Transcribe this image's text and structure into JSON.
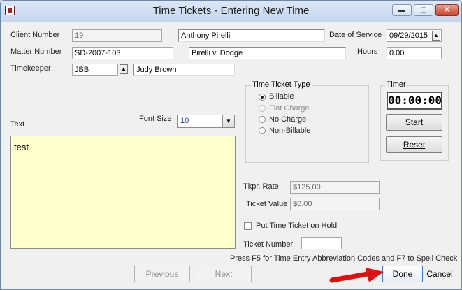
{
  "window": {
    "title": "Time Tickets - Entering New Time",
    "controls": {
      "minimize": "▬",
      "maximize": "▢",
      "close": "✕"
    }
  },
  "client": {
    "label": "Client Number",
    "number": "19",
    "name": "Anthony Pirelli"
  },
  "date_of_service": {
    "label": "Date of Service",
    "value": "09/29/2015"
  },
  "matter": {
    "label": "Matter Number",
    "number": "SD-2007-103",
    "name": "Pirelli v. Dodge"
  },
  "hours": {
    "label": "Hours",
    "value": "0.00"
  },
  "timekeeper": {
    "label": "Timekeeper",
    "code": "JBB",
    "name": "Judy Brown"
  },
  "ticket_type": {
    "title": "Time Ticket Type",
    "options": [
      "Billable",
      "Flat Charge",
      "No Charge",
      "Non-Billable"
    ],
    "selected": "Billable"
  },
  "timer": {
    "title": "Timer",
    "display": "00:00:00",
    "start_label": "Start",
    "reset_label": "Reset"
  },
  "text_editor": {
    "label": "Text",
    "font_size_label": "Font Size",
    "font_size_value": "10",
    "content": "test"
  },
  "rates": {
    "tkpr_rate_label": "Tkpr. Rate",
    "tkpr_rate_value": "$125.00",
    "ticket_value_label": "Ticket Value",
    "ticket_value_value": "$0.00"
  },
  "hold": {
    "label": "Put Time Ticket on Hold",
    "checked": false
  },
  "ticket_number": {
    "label": "Ticket Number",
    "value": ""
  },
  "hint": "Press F5 for Time Entry Abbreviation Codes and F7 to Spell Check",
  "buttons": {
    "previous": "Previous",
    "next": "Next",
    "done": "Done",
    "cancel": "Cancel"
  },
  "colors": {
    "text_bg": "#ffffcc",
    "arrow": "#e01010",
    "titlebar": "#c4d6ee"
  }
}
